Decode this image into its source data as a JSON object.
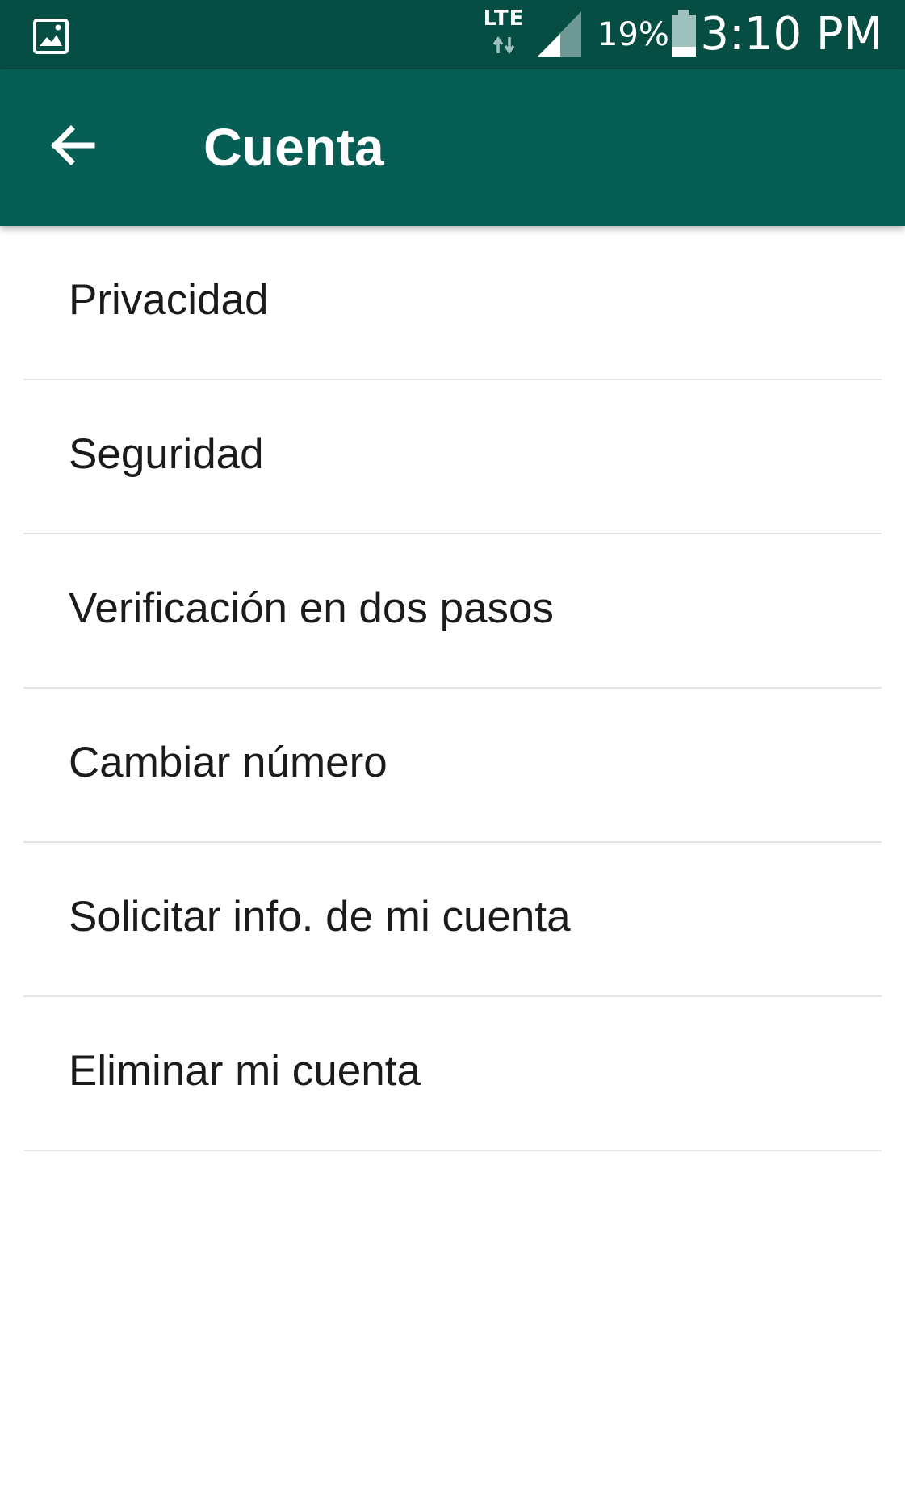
{
  "status_bar": {
    "network_type": "LTE",
    "battery_percent": "19%",
    "time": "3:10 PM",
    "icons": [
      "gallery-icon",
      "data-arrows-icon",
      "signal-icon",
      "battery-icon"
    ]
  },
  "app_bar": {
    "back_icon": "arrow-left-icon",
    "title": "Cuenta"
  },
  "settings": {
    "items": [
      {
        "label": "Privacidad"
      },
      {
        "label": "Seguridad"
      },
      {
        "label": "Verificación en dos pasos"
      },
      {
        "label": "Cambiar número"
      },
      {
        "label": "Solicitar info. de mi cuenta"
      },
      {
        "label": "Eliminar mi cuenta"
      }
    ]
  },
  "colors": {
    "status_bar": "#064d44",
    "app_bar": "#075e54",
    "background": "#ffffff",
    "text": "#1b1b1b",
    "divider": "#e4e4e4"
  }
}
